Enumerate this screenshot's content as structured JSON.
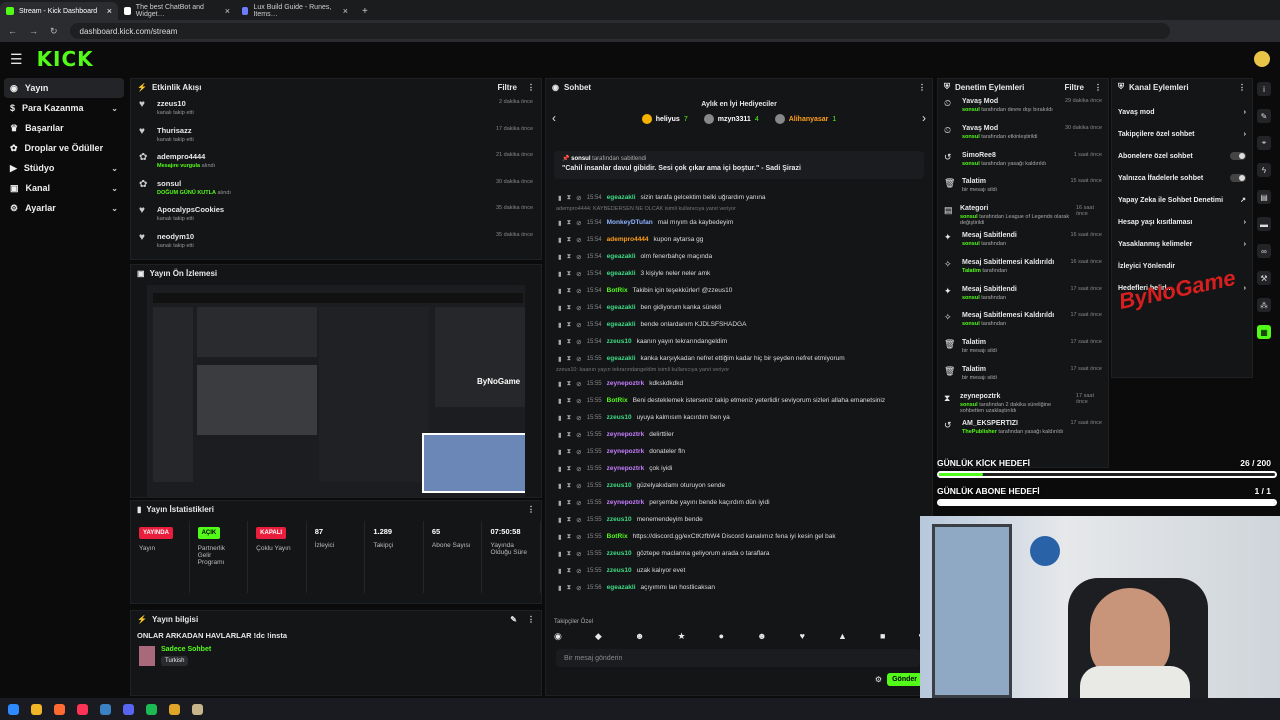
{
  "browser": {
    "tabs": [
      {
        "label": "Stream - Kick Dashboard",
        "color": "#53fc18"
      },
      {
        "label": "The best ChatBot and Widget…",
        "color": "#ffffff"
      },
      {
        "label": "Lux Build Guide - Runes, Items…",
        "color": "#6b7cff"
      }
    ],
    "url": "dashboard.kick.com/stream"
  },
  "brand": {
    "logo": "KICK"
  },
  "sidebar": {
    "items": [
      {
        "label": "Yayın",
        "icon": "broadcast-icon",
        "chev": ""
      },
      {
        "label": "Para Kazanma",
        "icon": "dollar-icon",
        "chev": "⌄"
      },
      {
        "label": "Başarılar",
        "icon": "trophy-icon",
        "chev": ""
      },
      {
        "label": "Droplar ve Ödüller",
        "icon": "gift-icon",
        "chev": ""
      },
      {
        "label": "Stüdyo",
        "icon": "studio-icon",
        "chev": "⌄"
      },
      {
        "label": "Kanal",
        "icon": "channel-icon",
        "chev": "⌄"
      },
      {
        "label": "Ayarlar",
        "icon": "gear-icon",
        "chev": "⌄"
      }
    ]
  },
  "activity": {
    "title": "Etkinlik Akışı",
    "filter": "Filtre",
    "items": [
      {
        "name": "zzeus10",
        "desc": "kanalı takip etti",
        "time": "2 dakika önce",
        "icon": "heart-icon"
      },
      {
        "name": "Thurisazz",
        "desc": "kanalı takip etti",
        "time": "17 dakika önce",
        "icon": "heart-icon"
      },
      {
        "name": "adempro4444",
        "desc": "Mesajını vurgula",
        "desc2": "alındı",
        "time": "21 dakika önce",
        "icon": "gift-icon"
      },
      {
        "name": "sonsul",
        "desc": "DOĞUM GÜNÜ KUTLA",
        "desc2": "alındı",
        "time": "30 dakika önce",
        "icon": "gift-icon"
      },
      {
        "name": "ApocalypsCookies",
        "desc": "kanalı takip etti",
        "time": "35 dakika önce",
        "icon": "heart-icon"
      },
      {
        "name": "neodym10",
        "desc": "kanalı takip etti",
        "time": "35 dakika önce",
        "icon": "heart-icon"
      }
    ]
  },
  "preview": {
    "title": "Yayın Ön İzlemesi",
    "watermark": "ByNoGame"
  },
  "stats": {
    "title": "Yayın İstatistikleri",
    "boxes": [
      {
        "badge": "YAYINDA",
        "badge_color": "#e91e3c",
        "label": "Yayın"
      },
      {
        "badge": "AÇIK",
        "badge_color": "#53fc18",
        "label": "Partnerlik Gelir Programı"
      },
      {
        "badge": "KAPALI",
        "badge_color": "#e91e3c",
        "label": "Çoklu Yayın"
      },
      {
        "value": "87",
        "label": "İzleyici"
      },
      {
        "value": "1.289",
        "label": "Takipçi"
      },
      {
        "value": "65",
        "label": "Abone Sayısı"
      },
      {
        "value": "07:50:58",
        "label": "Yayında Olduğu Süre"
      }
    ]
  },
  "info": {
    "title": "Yayın bilgisi",
    "stream_title": "ONLAR ARKADAN HAVLARLAR !dc !insta",
    "category": "Sadece Sohbet",
    "language": "Turkish"
  },
  "chat": {
    "title": "Sohbet",
    "top": {
      "title": "Aylık en İyi Hediyeciler",
      "users": [
        {
          "name": "heliyus",
          "count": "7"
        },
        {
          "name": "mzyn3311",
          "count": "4"
        },
        {
          "name": "Alihanyasar",
          "count": "1"
        }
      ]
    },
    "pinned": {
      "by": "sonsul",
      "by_suffix": "tarafından sabitlendi",
      "text": "\"Cahil insanlar davul gibidir. Sesi çok çıkar ama içi boştur.\" - Sadi Şirazi"
    },
    "lines": [
      {
        "time": "15:54",
        "user": "egeazakli",
        "color": "#3ddc84",
        "msg": "sizin tarafa gelcektim belki uğrardım yanına"
      },
      {
        "sys": "adempro4444: KAYBEDERSEN NE OLCAK isimli kullanıcıya yanıt veriyor"
      },
      {
        "time": "15:54",
        "user": "MonkeyDTufan",
        "color": "#8fb3ff",
        "msg": "mal mıyım da kaybedeyim"
      },
      {
        "time": "15:54",
        "user": "adempro4444",
        "color": "#ff9f1a",
        "msg": "kupon aytarsa gg"
      },
      {
        "time": "15:54",
        "user": "egeazakli",
        "color": "#3ddc84",
        "msg": "olm fenerbahçe maçında"
      },
      {
        "time": "15:54",
        "user": "egeazakli",
        "color": "#3ddc84",
        "msg": "3 kişiyle neler neler amk"
      },
      {
        "time": "15:54",
        "user": "BotRix",
        "color": "#53fc18",
        "msg": "Takibin için teşekkürler! @zzeus10"
      },
      {
        "time": "15:54",
        "user": "egeazakli",
        "color": "#3ddc84",
        "msg": "ben gidiyorum kanka sürekli"
      },
      {
        "time": "15:54",
        "user": "egeazakli",
        "color": "#3ddc84",
        "msg": "bende onlardanım KJDLSFSHADGA"
      },
      {
        "time": "15:54",
        "user": "zzeus10",
        "color": "#3ddc84",
        "msg": "kaanın yayın tekrarındangeldim"
      },
      {
        "time": "15:55",
        "user": "egeazakli",
        "color": "#3ddc84",
        "msg": "kanka karşıykadan nefret ettiğim kadar hiç bir şeyden nefret etmiyorum"
      },
      {
        "sys": "zzeus10: kaanın yayın tekrarındangeldim isimli kullanıcıya yanıt veriyor"
      },
      {
        "time": "15:55",
        "user": "zeynepoztrk",
        "color": "#c77dff",
        "msg": "kdkskdkdkd"
      },
      {
        "time": "15:55",
        "user": "BotRix",
        "color": "#53fc18",
        "msg": "Beni desteklemek isterseniz takip etmeniz yeterlidir seviyorum sizleri allaha emanetsiniz"
      },
      {
        "time": "15:55",
        "user": "zzeus10",
        "color": "#3ddc84",
        "msg": "uyuya kalmısım kacırdım ben ya"
      },
      {
        "time": "15:55",
        "user": "zeynepoztrk",
        "color": "#c77dff",
        "msg": "delirttiler"
      },
      {
        "time": "15:55",
        "user": "zeynepoztrk",
        "color": "#c77dff",
        "msg": "donateler fln"
      },
      {
        "time": "15:55",
        "user": "zeynepoztrk",
        "color": "#c77dff",
        "msg": "çok iyidi"
      },
      {
        "time": "15:55",
        "user": "zzeus10",
        "color": "#3ddc84",
        "msg": "güzelyakıdamı oturuyon sende"
      },
      {
        "time": "15:55",
        "user": "zeynepoztrk",
        "color": "#c77dff",
        "msg": "perşembe yayını bende kaçırdım dün iyidi"
      },
      {
        "time": "15:55",
        "user": "zzeus10",
        "color": "#3ddc84",
        "msg": "menemendeyim bende"
      },
      {
        "time": "15:55",
        "user": "BotRix",
        "color": "#53fc18",
        "msg": "https://discord.gg/exCtKzfbW4 Discord kanalımız fena iyi kesin gel bak"
      },
      {
        "time": "15:55",
        "user": "zzeus10",
        "color": "#3ddc84",
        "msg": "göztepe maclarına geliyorum arada o taraflara"
      },
      {
        "time": "15:55",
        "user": "zzeus10",
        "color": "#3ddc84",
        "msg": "uzak kalıyor evet"
      },
      {
        "time": "15:56",
        "user": "egeazakli",
        "color": "#3ddc84",
        "msg": "açıyımmı lan hostlicaksan"
      }
    ],
    "emote_label": "Takipçiler Özel",
    "input_placeholder": "Bir mesaj gönderin",
    "send": "Gönder"
  },
  "mod": {
    "title": "Denetim Eylemleri",
    "filter": "Filtre",
    "items": [
      {
        "name": "Yavaş Mod",
        "by": "sonsul",
        "desc": "tarafından devre dışı bırakıldı",
        "time": "29 dakika önce",
        "icon": "slow-icon"
      },
      {
        "name": "Yavaş Mod",
        "by": "sonsul",
        "desc": "tarafından etkinleştirildi",
        "time": "30 dakika önce",
        "icon": "slow-icon"
      },
      {
        "name": "SimoRee8",
        "by": "sonsul",
        "desc": "tarafından yasağı kaldırıldı",
        "time": "1 saat önce",
        "icon": "unban-icon"
      },
      {
        "name": "Talatim",
        "by": "",
        "desc": "bir mesajı sildi",
        "time": "15 saat önce",
        "icon": "trash-icon"
      },
      {
        "name": "Kategori",
        "by": "sonsul",
        "desc": "tarafından League of Legends olarak değiştirildi",
        "time": "16 saat önce",
        "icon": "category-icon"
      },
      {
        "name": "Mesaj Sabitlendi",
        "by": "sonsul",
        "desc": "tarafından",
        "time": "16 saat önce",
        "icon": "pin-icon"
      },
      {
        "name": "Mesaj Sabitlemesi Kaldırıldı",
        "by": "Talatim",
        "desc": "tarafından",
        "time": "16 saat önce",
        "icon": "unpin-icon"
      },
      {
        "name": "Mesaj Sabitlendi",
        "by": "sonsul",
        "desc": "tarafından",
        "time": "17 saat önce",
        "icon": "pin-icon"
      },
      {
        "name": "Mesaj Sabitlemesi Kaldırıldı",
        "by": "sonsul",
        "desc": "tarafından",
        "time": "17 saat önce",
        "icon": "unpin-icon"
      },
      {
        "name": "Talatim",
        "by": "",
        "desc": "bir mesajı sildi",
        "time": "17 saat önce",
        "icon": "trash-icon"
      },
      {
        "name": "Talatim",
        "by": "",
        "desc": "bir mesajı sildi",
        "time": "17 saat önce",
        "icon": "trash-icon"
      },
      {
        "name": "zeynepoztrk",
        "by": "sonsul",
        "desc": "tarafından 2 dakika süreliğine sohbetten uzaklaştırıldı",
        "time": "17 saat önce",
        "icon": "timeout-icon"
      },
      {
        "name": "AM_EKSPERTIZI",
        "by": "ThePublisher",
        "desc": "tarafından yasağı kaldırıldı",
        "time": "17 saat önce",
        "icon": "unban-icon"
      }
    ]
  },
  "channel": {
    "title": "Kanal Eylemleri",
    "items": [
      {
        "label": "Yavaş mod",
        "ctrl": "›"
      },
      {
        "label": "Takipçilere özel sohbet",
        "ctrl": "›"
      },
      {
        "label": "Abonelere özel sohbet",
        "ctrl": "toggle"
      },
      {
        "label": "Yalnızca İfadelerle sohbet",
        "ctrl": "toggle"
      },
      {
        "label": "Yapay Zeka ile Sohbet Denetimi",
        "ctrl": "↗"
      },
      {
        "label": "Hesap yaşı kısıtlaması",
        "ctrl": "›"
      },
      {
        "label": "Yasaklanmış kelimeler",
        "ctrl": "›"
      },
      {
        "label": "İzleyici Yönlendir",
        "ctrl": ""
      },
      {
        "label": "Hedefleri belirl...",
        "ctrl": "›"
      }
    ],
    "watermark": "ByNoGame"
  },
  "goals": [
    {
      "label": "GÜNLÜK KİCK HEDEFİ",
      "value": "26 / 200",
      "fraction": 0.13
    },
    {
      "label": "GÜNLÜK ABONE HEDEFİ",
      "value": "1 / 1",
      "fraction": 1.0
    }
  ]
}
